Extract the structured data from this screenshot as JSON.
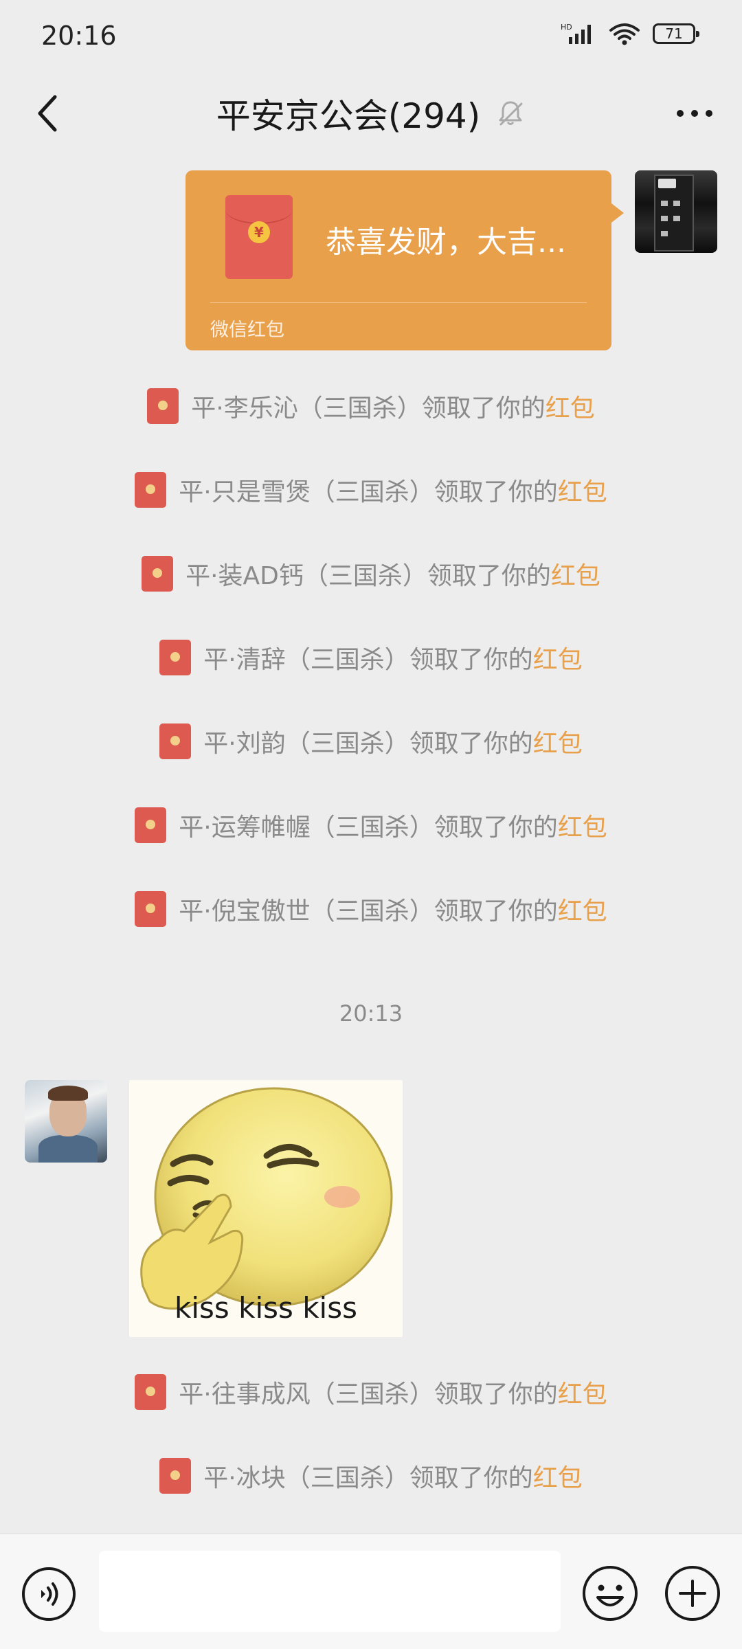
{
  "status_bar": {
    "time": "20:16",
    "battery": "71",
    "network": "HD"
  },
  "header": {
    "title": "平安京公会(294)"
  },
  "red_packet": {
    "greeting": "恭喜发财，大吉...",
    "label": "微信红包",
    "currency_glyph": "¥"
  },
  "notices_top": [
    {
      "prefix": "平·李乐沁（三国杀）领取了你的",
      "link": "红包"
    },
    {
      "prefix": "平·只是雪煲（三国杀）领取了你的",
      "link": "红包"
    },
    {
      "prefix": "平·装AD钙（三国杀）领取了你的",
      "link": "红包"
    },
    {
      "prefix": "平·清辞（三国杀）领取了你的",
      "link": "红包"
    },
    {
      "prefix": "平·刘韵（三国杀）领取了你的",
      "link": "红包"
    },
    {
      "prefix": "平·运筹帷幄（三国杀）领取了你的",
      "link": "红包"
    },
    {
      "prefix": "平·倪宝傲世（三国杀）领取了你的",
      "link": "红包"
    }
  ],
  "timestamp": "20:13",
  "sticker": {
    "caption": "kiss kiss kiss"
  },
  "notices_bottom": [
    {
      "prefix": "平·往事成风（三国杀）领取了你的",
      "link": "红包"
    },
    {
      "prefix": "平·冰块（三国杀）领取了你的",
      "link": "红包"
    }
  ],
  "input": {
    "value": ""
  },
  "icons": {
    "back": "chevron-left-icon",
    "mute": "bell-off-icon",
    "more": "more-horizontal-icon",
    "voice": "voice-icon",
    "emoji": "emoji-icon",
    "plus": "plus-icon"
  },
  "colors": {
    "background": "#ededed",
    "red_packet": "#e9a04b",
    "highlight": "#e9a04b",
    "notice_text": "#8a8a8a"
  }
}
